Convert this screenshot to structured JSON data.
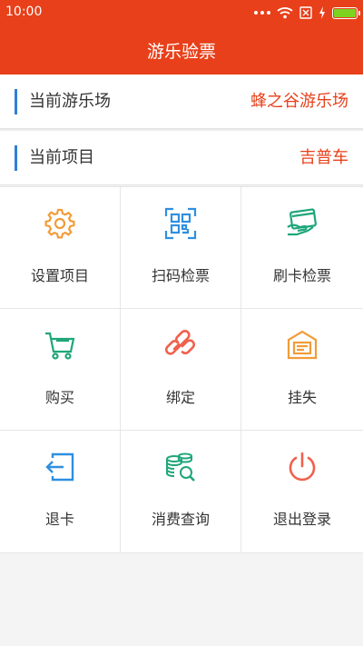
{
  "status_bar": {
    "time": "10:00"
  },
  "header": {
    "title": "游乐验票"
  },
  "info": {
    "park_label": "当前游乐场",
    "park_value": "蜂之谷游乐场",
    "project_label": "当前项目",
    "project_value": "吉普车"
  },
  "menu": [
    {
      "label": "设置项目",
      "icon": "gear-icon",
      "color": "#f29c38"
    },
    {
      "label": "扫码检票",
      "icon": "qr-scan-icon",
      "color": "#2f8fe0"
    },
    {
      "label": "刷卡检票",
      "icon": "card-swipe-icon",
      "color": "#1fa67a"
    },
    {
      "label": "购买",
      "icon": "cart-icon",
      "color": "#1fa67a"
    },
    {
      "label": "绑定",
      "icon": "link-icon",
      "color": "#f0614e"
    },
    {
      "label": "挂失",
      "icon": "report-loss-icon",
      "color": "#f29c38"
    },
    {
      "label": "退卡",
      "icon": "return-card-icon",
      "color": "#2f8fe0"
    },
    {
      "label": "消费查询",
      "icon": "coins-search-icon",
      "color": "#1fa67a"
    },
    {
      "label": "退出登录",
      "icon": "power-icon",
      "color": "#f0614e"
    }
  ],
  "colors": {
    "brand": "#e8401a",
    "accent_bar": "#2f7fd6",
    "battery": "#7ed321"
  }
}
